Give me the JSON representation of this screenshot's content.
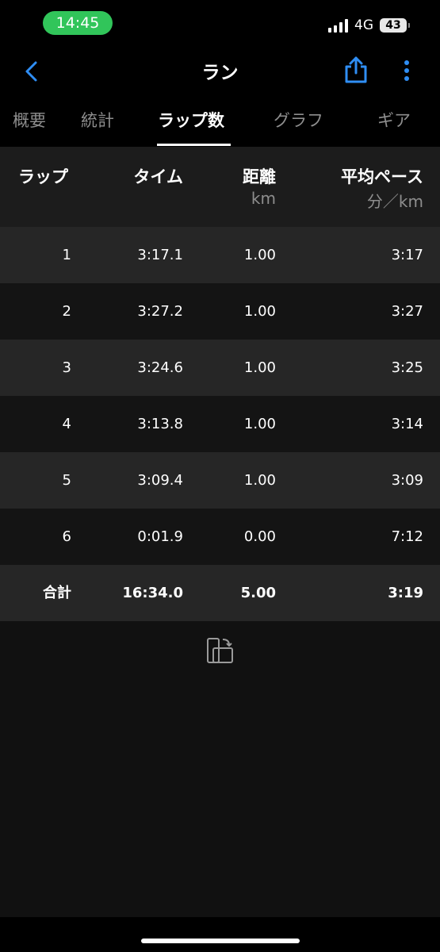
{
  "status_bar": {
    "time": "14:45",
    "network": "4G",
    "battery": "43"
  },
  "nav": {
    "title": "ラン"
  },
  "tabs": [
    {
      "label": "概要"
    },
    {
      "label": "統計"
    },
    {
      "label": "ラップ数",
      "active": true
    },
    {
      "label": "グラフ"
    },
    {
      "label": "ギア"
    }
  ],
  "table": {
    "headers": {
      "lap": "ラップ",
      "time": "タイム",
      "distance": "距離",
      "distance_unit": "km",
      "avg_pace": "平均ペース",
      "avg_pace_unit": "分／km"
    },
    "rows": [
      {
        "lap": "1",
        "time": "3:17.1",
        "distance": "1.00",
        "pace": "3:17"
      },
      {
        "lap": "2",
        "time": "3:27.2",
        "distance": "1.00",
        "pace": "3:27"
      },
      {
        "lap": "3",
        "time": "3:24.6",
        "distance": "1.00",
        "pace": "3:25"
      },
      {
        "lap": "4",
        "time": "3:13.8",
        "distance": "1.00",
        "pace": "3:14"
      },
      {
        "lap": "5",
        "time": "3:09.4",
        "distance": "1.00",
        "pace": "3:09"
      },
      {
        "lap": "6",
        "time": "0:01.9",
        "distance": "0.00",
        "pace": "7:12"
      }
    ],
    "total": {
      "lap": "合計",
      "time": "16:34.0",
      "distance": "5.00",
      "pace": "3:19"
    }
  },
  "colors": {
    "accent": "#2f8ef4",
    "status_pill": "#31c55a"
  },
  "icons": {
    "back": "chevron-left-icon",
    "share": "share-icon",
    "more": "more-vertical-icon",
    "rotate": "phone-rotate-icon"
  }
}
